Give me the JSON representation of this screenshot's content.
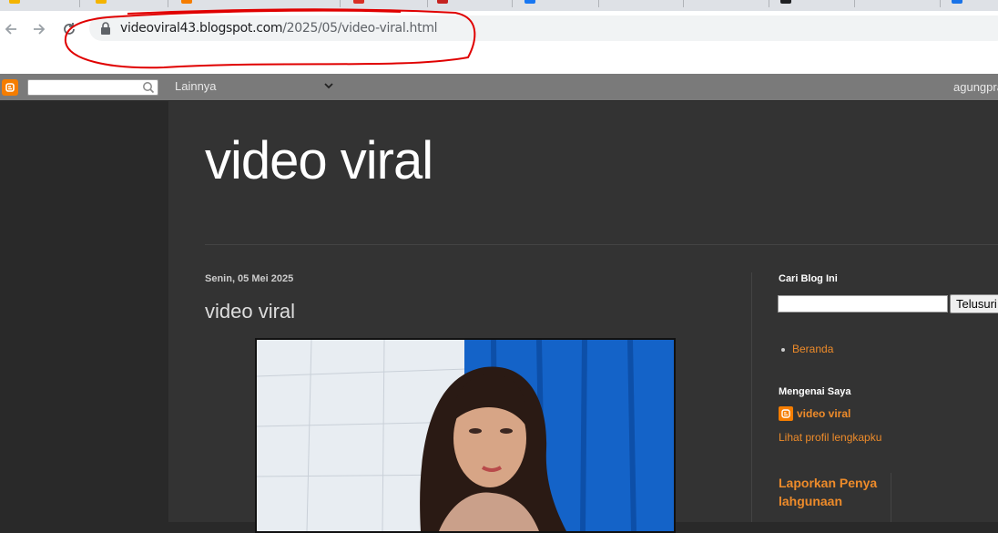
{
  "browser": {
    "url_host": "videoviral43.blogspot.com",
    "url_path": "/2025/05/video-viral.html"
  },
  "navbar": {
    "more_label": "Lainnya",
    "user_label": "agungpra"
  },
  "blog": {
    "title": "video viral"
  },
  "post": {
    "date": "Senin, 05 Mei 2025",
    "title": "video viral"
  },
  "sidebar": {
    "search_heading": "Cari Blog Ini",
    "search_button": "Telusuri",
    "pages": [
      {
        "label": "Beranda"
      }
    ],
    "about_heading": "Mengenai Saya",
    "profile_name": "video viral",
    "profile_link": "Lihat profil lengkapku",
    "report_label": "Laporkan Penyalahgunaan"
  },
  "colors": {
    "accent": "#ee8b2a",
    "annotation": "#e00000",
    "blogger": "#f57d00"
  },
  "icons": [
    "back-arrow-icon",
    "forward-arrow-icon",
    "reload-icon",
    "lock-icon",
    "blogger-icon",
    "search-icon",
    "chevron-down-icon"
  ]
}
